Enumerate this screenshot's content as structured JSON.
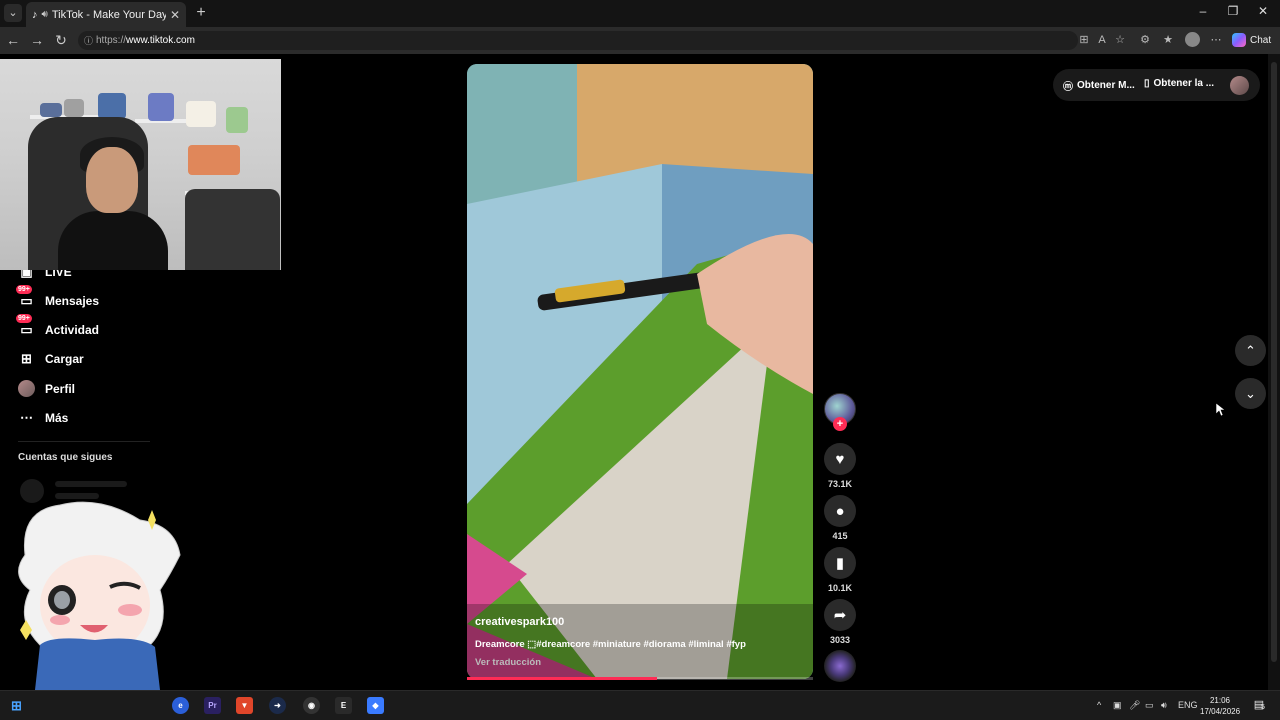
{
  "browser": {
    "tab_title": "TikTok - Make Your Day",
    "url_prefix": "https://",
    "url_host": "www.tiktok.com",
    "chat_label": "Chat"
  },
  "sidebar": {
    "items": [
      {
        "label": "LIVE",
        "icon": "live-icon"
      },
      {
        "label": "Mensajes",
        "icon": "messages-icon",
        "badge": "99+"
      },
      {
        "label": "Actividad",
        "icon": "activity-icon",
        "badge": "99+"
      },
      {
        "label": "Cargar",
        "icon": "upload-icon"
      },
      {
        "label": "Perfil",
        "icon": "profile-avatar"
      },
      {
        "label": "Más",
        "icon": "more-icon"
      }
    ],
    "following_title": "Cuentas que sigues"
  },
  "video": {
    "username": "creativespark100",
    "description": "Dreamcore ⬚#dreamcore #miniature #diorama #liminal #fyp",
    "translate_label": "Ver traducción",
    "progress": 0.55
  },
  "actions": {
    "likes": "73.1K",
    "comments": "415",
    "saves": "10.1K",
    "shares": "3033"
  },
  "topbar": {
    "get_coins": "Obtener M...",
    "get_app": "Obtener la ..."
  },
  "taskbar": {
    "lang": "ENG",
    "time": "21:06",
    "date": "17/04/2026",
    "notifications": "5"
  },
  "colors": {
    "accent": "#fe2c55",
    "background": "#000000"
  }
}
